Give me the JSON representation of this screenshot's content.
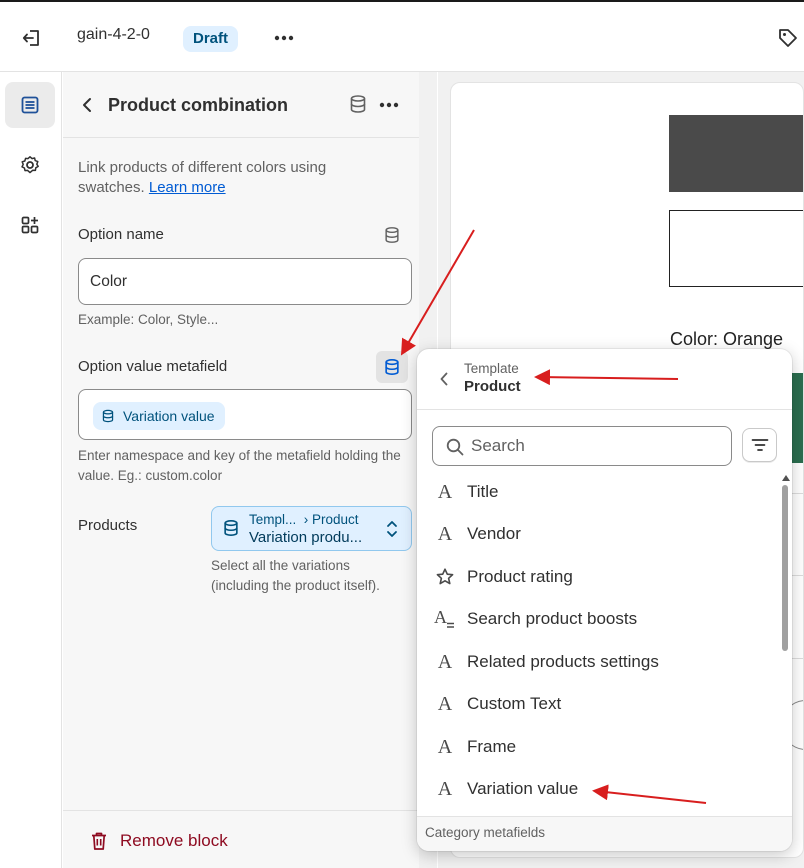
{
  "topbar": {
    "theme_name": "gain-4-2-0",
    "status_badge": "Draft"
  },
  "rail": {
    "items": [
      {
        "icon": "sections-icon",
        "active": true
      },
      {
        "icon": "gear-icon",
        "active": false
      },
      {
        "icon": "apps-add-icon",
        "active": false
      }
    ]
  },
  "panel": {
    "title": "Product combination",
    "description": "Link products of different colors using swatches.",
    "learn_more": "Learn more",
    "option_name_label": "Option name",
    "option_name_value": "Color",
    "option_name_help": "Example: Color, Style...",
    "option_value_label": "Option value metafield",
    "option_value_chip": "Variation value",
    "option_value_help": "Enter namespace and key of the metafield holding the value. Eg.: custom.color",
    "products_label": "Products",
    "products_source_prefix": "Templ...",
    "products_source_suffix": "› Product",
    "products_value": "Variation produ...",
    "products_help": "Select all the variations (including the product itself).",
    "remove_label": "Remove block"
  },
  "preview": {
    "color_label": "Color: Orange"
  },
  "popover": {
    "breadcrumb": "Template",
    "title": "Product",
    "search_placeholder": "Search",
    "items": [
      {
        "label": "Title",
        "icon": "text-icon"
      },
      {
        "label": "Vendor",
        "icon": "text-icon"
      },
      {
        "label": "Product rating",
        "icon": "star-icon"
      },
      {
        "label": "Search product boosts",
        "icon": "text-list-icon"
      },
      {
        "label": "Related products settings",
        "icon": "text-icon"
      },
      {
        "label": "Custom Text",
        "icon": "text-icon"
      },
      {
        "label": "Frame",
        "icon": "text-icon"
      },
      {
        "label": "Variation value",
        "icon": "text-icon"
      }
    ],
    "section_label": "Category metafields"
  },
  "colors": {
    "accent_blue": "#005bd3",
    "chip_bg": "#e0f0ff",
    "danger": "#8e0b21",
    "annotation_arrow": "#d81e1e"
  }
}
